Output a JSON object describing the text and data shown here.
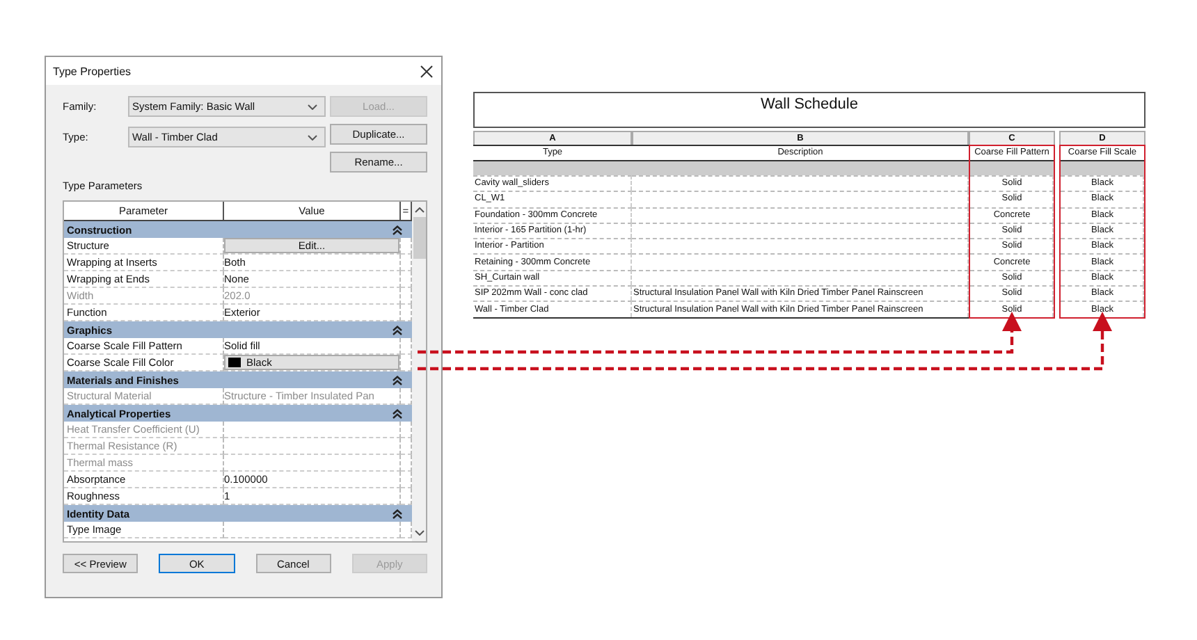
{
  "dialog": {
    "title": "Type Properties",
    "family": {
      "label": "Family:",
      "value": "System Family: Basic Wall"
    },
    "type": {
      "label": "Type:",
      "value": "Wall - Timber Clad"
    },
    "side_buttons": [
      {
        "label": "Load...",
        "disabled": true
      },
      {
        "label": "Duplicate...",
        "disabled": false
      },
      {
        "label": "Rename...",
        "disabled": false
      }
    ],
    "section_label": "Type Parameters",
    "columns": [
      "Parameter",
      "Value",
      "="
    ],
    "groups": [
      {
        "name": "Construction",
        "expanded": true,
        "params": [
          {
            "name": "Structure",
            "kind": "button",
            "value": "Edit...",
            "disabled": false
          },
          {
            "name": "Wrapping at Inserts",
            "kind": "text",
            "value": "Both",
            "disabled": false
          },
          {
            "name": "Wrapping at Ends",
            "kind": "text",
            "value": "None",
            "disabled": false
          },
          {
            "name": "Width",
            "kind": "text",
            "value": "202.0",
            "disabled": true
          },
          {
            "name": "Function",
            "kind": "text",
            "value": "Exterior",
            "disabled": false
          }
        ]
      },
      {
        "name": "Graphics",
        "expanded": true,
        "params": [
          {
            "name": "Coarse Scale Fill Pattern",
            "kind": "text",
            "value": "Solid fill",
            "disabled": false
          },
          {
            "name": "Coarse Scale Fill Color",
            "kind": "color",
            "value": "Black",
            "color": "#000000",
            "disabled": false
          }
        ]
      },
      {
        "name": "Materials and Finishes",
        "expanded": true,
        "params": [
          {
            "name": "Structural Material",
            "kind": "text",
            "value": "Structure - Timber Insulated Pan",
            "disabled": true
          }
        ]
      },
      {
        "name": "Analytical Properties",
        "expanded": true,
        "params": [
          {
            "name": "Heat Transfer Coefficient (U)",
            "kind": "text",
            "disabled": true
          },
          {
            "name": "Thermal Resistance (R)",
            "kind": "text",
            "disabled": true
          },
          {
            "name": "Thermal mass",
            "kind": "text",
            "disabled": true
          },
          {
            "name": "Absorptance",
            "kind": "text",
            "value": "0.100000",
            "disabled": false
          },
          {
            "name": "Roughness",
            "kind": "text",
            "value": "1",
            "disabled": false
          }
        ]
      },
      {
        "name": "Identity Data",
        "expanded": true,
        "params": [
          {
            "name": "Type Image",
            "kind": "text",
            "disabled": false
          }
        ]
      }
    ],
    "buttons": [
      {
        "label": "<< Preview",
        "default": false,
        "disabled": false
      },
      {
        "label": "OK",
        "default": true,
        "disabled": false
      },
      {
        "label": "Cancel",
        "default": false,
        "disabled": false
      },
      {
        "label": "Apply",
        "default": false,
        "disabled": true
      }
    ]
  },
  "schedule": {
    "title": "Wall Schedule",
    "columns": [
      {
        "letter": "A",
        "header": "Type",
        "highlighted": false
      },
      {
        "letter": "B",
        "header": "Description",
        "highlighted": false
      },
      {
        "letter": "C",
        "header": "Coarse Fill Pattern",
        "highlighted": true
      },
      {
        "letter": "D",
        "header": "Coarse Fill Scale",
        "highlighted": true
      }
    ],
    "rows": [
      {
        "type": "Cavity wall_sliders",
        "fill_pattern": "Solid",
        "fill_scale": "Black"
      },
      {
        "type": "CL_W1",
        "fill_pattern": "Solid",
        "fill_scale": "Black"
      },
      {
        "type": "Foundation - 300mm Concrete",
        "fill_pattern": "Concrete",
        "fill_scale": "Black"
      },
      {
        "type": "Interior - 165 Partition (1-hr)",
        "fill_pattern": "Solid",
        "fill_scale": "Black"
      },
      {
        "type": "Interior - Partition",
        "fill_pattern": "Solid",
        "fill_scale": "Black"
      },
      {
        "type": "Retaining - 300mm Concrete",
        "fill_pattern": "Concrete",
        "fill_scale": "Black"
      },
      {
        "type": "SH_Curtain wall",
        "fill_pattern": "Solid",
        "fill_scale": "Black"
      },
      {
        "type": "SIP 202mm Wall - conc clad",
        "description": "Structural Insulation Panel Wall with Kiln Dried Timber Panel Rainscreen",
        "fill_pattern": "Solid",
        "fill_scale": "Black"
      },
      {
        "type": "Wall - Timber Clad",
        "description": "Structural Insulation Panel Wall with Kiln Dried Timber Panel Rainscreen",
        "fill_pattern": "Solid",
        "fill_scale": "Black"
      }
    ]
  }
}
